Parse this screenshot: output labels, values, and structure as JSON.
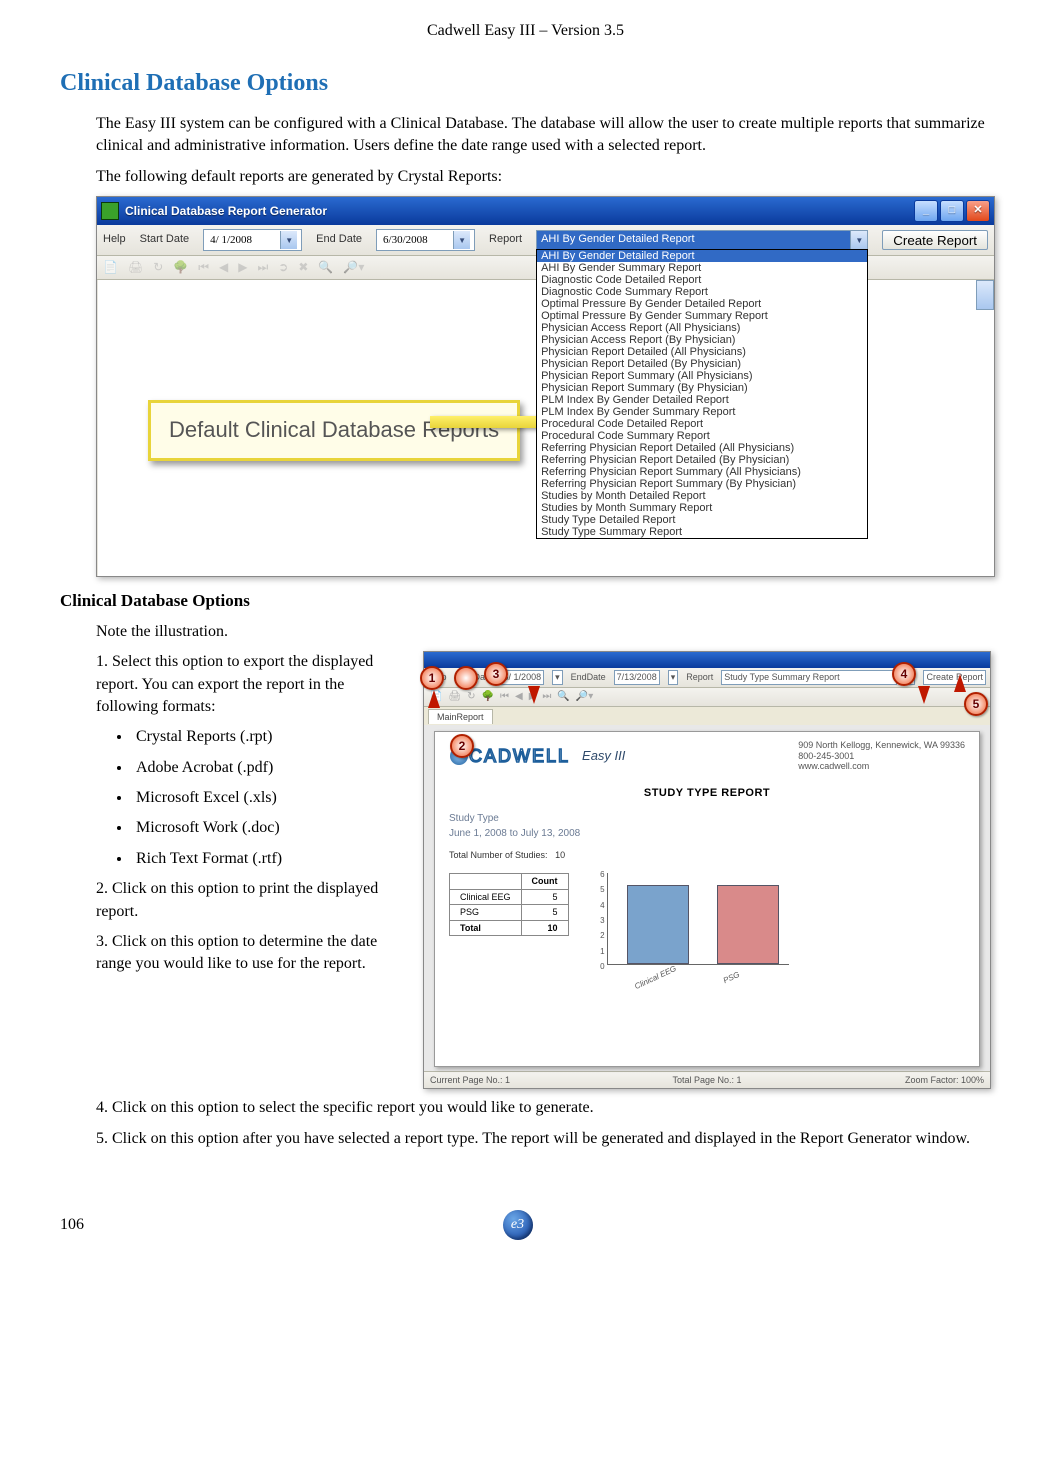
{
  "doc_header": "Cadwell Easy III – Version 3.5",
  "page_number": "106",
  "h1": "Clinical Database Options",
  "intro_p1": "The Easy III system can be configured with a Clinical Database.  The database will allow the user to create multiple reports that summarize clinical and administrative information.  Users define the date range used with a selected report.",
  "intro_p2": "The following default reports are generated by Crystal Reports:",
  "shot1": {
    "title": "Clinical Database Report Generator",
    "help": "Help",
    "start_date_lbl": "Start Date",
    "start_date_val": "4/ 1/2008",
    "end_date_lbl": "End Date",
    "end_date_val": "6/30/2008",
    "report_lbl": "Report",
    "create_btn": "Create Report",
    "selected_report": "AHI By Gender Detailed Report",
    "callout": "Default Clinical Database Reports",
    "options": [
      "AHI By Gender Detailed Report",
      "AHI By Gender Summary Report",
      "Diagnostic Code Detailed Report",
      "Diagnostic Code Summary Report",
      "Optimal Pressure By Gender Detailed Report",
      "Optimal Pressure By Gender Summary Report",
      "Physician Access Report (All Physicians)",
      "Physician Access Report (By Physician)",
      "Physician Report Detailed (All Physicians)",
      "Physician Report Detailed (By Physician)",
      "Physician Report Summary (All Physicians)",
      "Physician Report Summary (By Physician)",
      "PLM Index By Gender Detailed Report",
      "PLM Index By Gender Summary Report",
      "Procedural Code Detailed Report",
      "Procedural Code Summary Report",
      "Referring Physician Report Detailed (All Physicians)",
      "Referring Physician Report Detailed (By Physician)",
      "Referring Physician Report Summary (All Physicians)",
      "Referring Physician Report Summary (By Physician)",
      "Studies by Month Detailed Report",
      "Studies by Month Summary Report",
      "Study Type Detailed Report",
      "Study Type Summary Report"
    ]
  },
  "sub_heading": "Clinical Database Options",
  "note_illus": "Note the illustration.",
  "step1": "1.  Select this option to export the displayed report.  You can export the report in the following formats:",
  "formats": [
    "Crystal Reports (.rpt)",
    "Adobe Acrobat (.pdf)",
    "Microsoft Excel (.xls)",
    "Microsoft Work (.doc)",
    "Rich Text Format (.rtf)"
  ],
  "step2": "2.  Click on this option to print the displayed report.",
  "step3": "3.  Click on this option to determine the date range you would like to use for the report.",
  "step4": "4.  Click on this option to select the specific report you would like to generate.",
  "step5": "5.  Click on this option after you have selected a report type.  The report will be generated and displayed in the Report Generator window.",
  "shot2": {
    "help": "Help",
    "start_date_lbl": "StartDate",
    "start_date_val": "6/ 1/2008",
    "end_date_lbl": "EndDate",
    "end_date_val": "7/13/2008",
    "report_lbl": "Report",
    "report_val": "Study Type Summary Report",
    "create_btn": "Create Report",
    "tab": "MainReport",
    "co_line1": "909 North Kellogg, Kennewick, WA 99336",
    "co_line2": "800-245-3001",
    "co_line3": "www.cadwell.com",
    "logo_text": "CADWELL",
    "logo_script": "Easy III",
    "title": "STUDY TYPE REPORT",
    "sub1": "Study Type",
    "sub2": "June 1, 2008 to July 13, 2008",
    "total_lbl": "Total Number of Studies:",
    "total_val": "10",
    "col_count": "Count",
    "status_left": "Current Page No.: 1",
    "status_mid": "Total Page No.: 1",
    "status_right": "Zoom Factor: 100%"
  },
  "chart_data": {
    "type": "bar",
    "categories": [
      "Clinical EEG",
      "PSG"
    ],
    "values": [
      5,
      5
    ],
    "totals_row": {
      "label": "Total",
      "value": 10
    },
    "ylim": [
      0,
      6
    ],
    "yticks": [
      0,
      1,
      2,
      3,
      4,
      5,
      6
    ],
    "xlabel": "",
    "ylabel": "",
    "title": ""
  }
}
